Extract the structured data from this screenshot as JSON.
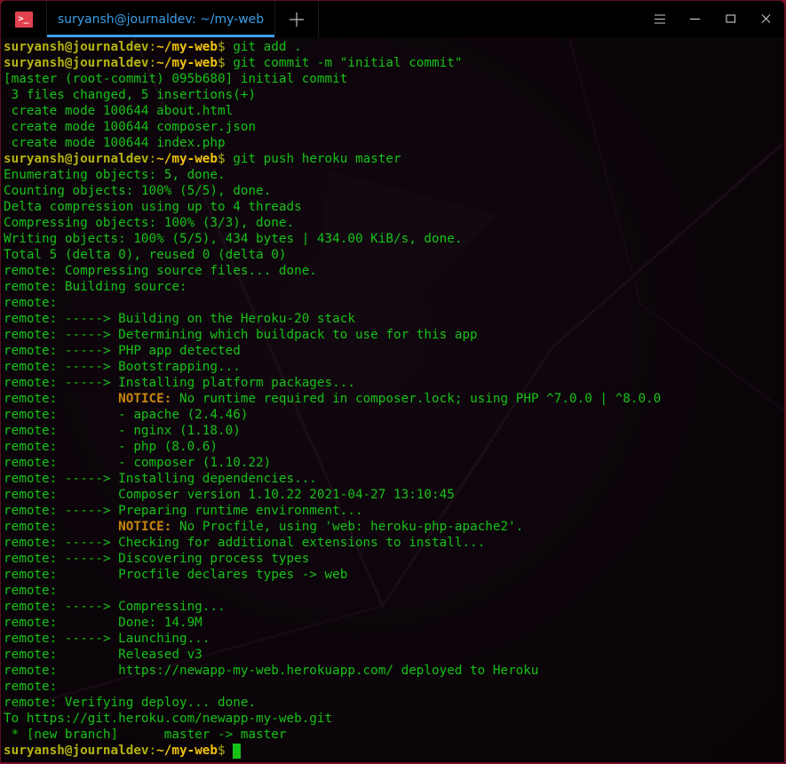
{
  "window": {
    "tab_title": "suryansh@journaldev: ~/my-web",
    "app_icon": "terminal-icon",
    "new_tab_icon": "plus-icon",
    "controls": [
      "hamburger-menu-icon",
      "minimize-icon",
      "maximize-icon",
      "close-icon"
    ]
  },
  "colors": {
    "prompt_user": "#b4b40e",
    "prompt_path": "#f0c20c",
    "output_text": "#17c217",
    "notice": "#c8860c",
    "tab_accent": "#3b9ee6",
    "app_icon_bg": "#e0434f"
  },
  "prompt": {
    "user_host": "suryansh@journaldev",
    "colon": ":",
    "path": "~/my-web",
    "symbol": "$"
  },
  "lines": [
    {
      "type": "prompt",
      "cmd": " git add ."
    },
    {
      "type": "prompt",
      "cmd": " git commit -m \"initial commit\""
    },
    {
      "type": "out",
      "text": "[master (root-commit) 095b680] initial commit"
    },
    {
      "type": "out",
      "text": " 3 files changed, 5 insertions(+)"
    },
    {
      "type": "out",
      "text": " create mode 100644 about.html"
    },
    {
      "type": "out",
      "text": " create mode 100644 composer.json"
    },
    {
      "type": "out",
      "text": " create mode 100644 index.php"
    },
    {
      "type": "prompt",
      "cmd": " git push heroku master"
    },
    {
      "type": "out",
      "text": "Enumerating objects: 5, done."
    },
    {
      "type": "out",
      "text": "Counting objects: 100% (5/5), done."
    },
    {
      "type": "out",
      "text": "Delta compression using up to 4 threads"
    },
    {
      "type": "out",
      "text": "Compressing objects: 100% (3/3), done."
    },
    {
      "type": "out",
      "text": "Writing objects: 100% (5/5), 434 bytes | 434.00 KiB/s, done."
    },
    {
      "type": "out",
      "text": "Total 5 (delta 0), reused 0 (delta 0)"
    },
    {
      "type": "out",
      "text": "remote: Compressing source files... done."
    },
    {
      "type": "out",
      "text": "remote: Building source:"
    },
    {
      "type": "out",
      "text": "remote:"
    },
    {
      "type": "out",
      "text": "remote: -----> Building on the Heroku-20 stack"
    },
    {
      "type": "out",
      "text": "remote: -----> Determining which buildpack to use for this app"
    },
    {
      "type": "out",
      "text": "remote: -----> PHP app detected"
    },
    {
      "type": "out",
      "text": "remote: -----> Bootstrapping..."
    },
    {
      "type": "out",
      "text": "remote: -----> Installing platform packages..."
    },
    {
      "type": "notice",
      "prefix": "remote:        ",
      "label": "NOTICE:",
      "text": " No runtime required in composer.lock; using PHP ^7.0.0 | ^8.0.0"
    },
    {
      "type": "out",
      "text": "remote:        - apache (2.4.46)"
    },
    {
      "type": "out",
      "text": "remote:        - nginx (1.18.0)"
    },
    {
      "type": "out",
      "text": "remote:        - php (8.0.6)"
    },
    {
      "type": "out",
      "text": "remote:        - composer (1.10.22)"
    },
    {
      "type": "out",
      "text": "remote: -----> Installing dependencies..."
    },
    {
      "type": "out",
      "text": "remote:        Composer version 1.10.22 2021-04-27 13:10:45"
    },
    {
      "type": "out",
      "text": "remote: -----> Preparing runtime environment..."
    },
    {
      "type": "notice",
      "prefix": "remote:        ",
      "label": "NOTICE:",
      "text": " No Procfile, using 'web: heroku-php-apache2'."
    },
    {
      "type": "out",
      "text": "remote: -----> Checking for additional extensions to install..."
    },
    {
      "type": "out",
      "text": "remote: -----> Discovering process types"
    },
    {
      "type": "out",
      "text": "remote:        Procfile declares types -> web"
    },
    {
      "type": "out",
      "text": "remote:"
    },
    {
      "type": "out",
      "text": "remote: -----> Compressing..."
    },
    {
      "type": "out",
      "text": "remote:        Done: 14.9M"
    },
    {
      "type": "out",
      "text": "remote: -----> Launching..."
    },
    {
      "type": "out",
      "text": "remote:        Released v3"
    },
    {
      "type": "out",
      "text": "remote:        https://newapp-my-web.herokuapp.com/ deployed to Heroku"
    },
    {
      "type": "out",
      "text": "remote:"
    },
    {
      "type": "out",
      "text": "remote: Verifying deploy... done."
    },
    {
      "type": "out",
      "text": "To https://git.heroku.com/newapp-my-web.git"
    },
    {
      "type": "out",
      "text": " * [new branch]      master -> master"
    },
    {
      "type": "prompt",
      "cmd": " ",
      "cursor": true
    }
  ]
}
